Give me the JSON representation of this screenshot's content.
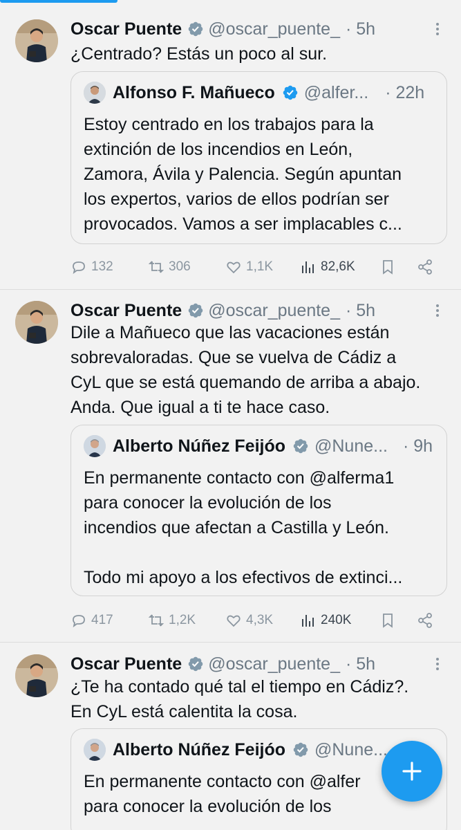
{
  "tweets": [
    {
      "name": "Oscar Puente",
      "handle": "@oscar_puente_",
      "time": "· 5h",
      "text": "¿Centrado? Estás un poco al sur.",
      "quote": {
        "name": "Alfonso F. Mañueco",
        "handle": "@alfer...",
        "time": "· 22h",
        "verified_color": "#1d9bf0",
        "text": "Estoy centrado en los trabajos para la\nextinción de los incendios en León,\nZamora, Ávila y Palencia. Según apuntan\nlos expertos, varios de ellos podrían ser\nprovocados. Vamos a ser implacables c..."
      },
      "stats": {
        "replies": "132",
        "reposts": "306",
        "likes": "1,1K",
        "views": "82,6K"
      }
    },
    {
      "name": "Oscar Puente",
      "handle": "@oscar_puente_",
      "time": "· 5h",
      "text": "Dile a Mañueco que las vacaciones están\nsobrevaloradas. Que se vuelva de Cádiz a\nCyL que se está quemando de arriba a abajo.\nAnda. Que igual a ti te hace caso.",
      "quote": {
        "name": "Alberto Núñez Feijóo",
        "handle": "@Nune...",
        "time": "· 9h",
        "verified_color": "#829aab",
        "text": "En permanente contacto con @alferma1\npara conocer la evolución de los\nincendios que afectan a Castilla y León.\n\nTodo mi apoyo a los efectivos de extinci..."
      },
      "stats": {
        "replies": "417",
        "reposts": "1,2K",
        "likes": "4,3K",
        "views": "240K"
      }
    },
    {
      "name": "Oscar Puente",
      "handle": "@oscar_puente_",
      "time": "· 5h",
      "text": "¿Te ha contado qué tal el tiempo en Cádiz?.\nEn CyL está calentita la cosa.",
      "quote": {
        "name": "Alberto Núñez Feijóo",
        "handle": "@Nune...",
        "time": "",
        "verified_color": "#829aab",
        "text": "En permanente contacto con @alfer\npara conocer la evolución de los"
      }
    }
  ],
  "colors": {
    "accent": "#1d9bf0",
    "muted": "#6b7884",
    "gold_verified": "#829aab"
  },
  "icons": [
    "more-icon",
    "reply-icon",
    "repost-icon",
    "like-icon",
    "views-icon",
    "bookmark-icon",
    "share-icon",
    "compose-plus-icon"
  ]
}
